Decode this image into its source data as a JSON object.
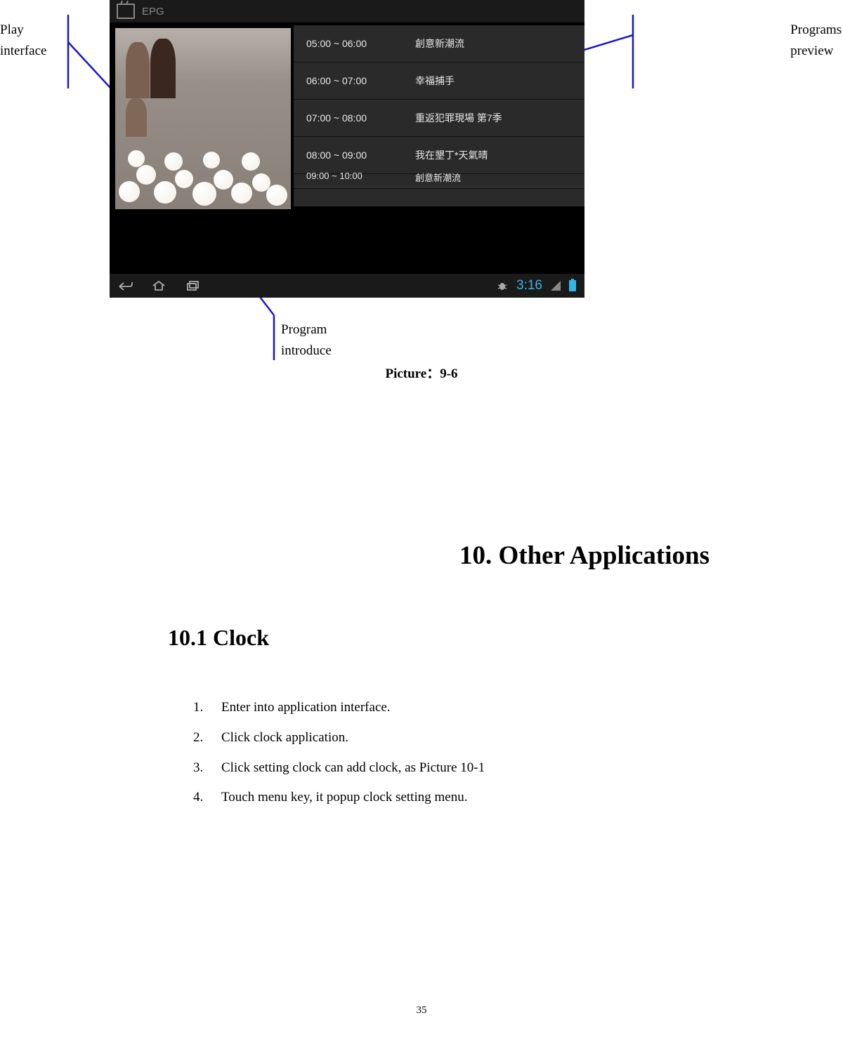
{
  "annotations": {
    "play_interface_l1": "Play",
    "play_interface_l2": "interface",
    "programs_preview_l1": "Programs",
    "programs_preview_l2": "preview",
    "program_introduce_l1": "Program",
    "program_introduce_l2": "introduce"
  },
  "screenshot": {
    "header_label": "EPG",
    "programs": [
      {
        "time": "05:00 ~ 06:00",
        "name": "創意新潮流"
      },
      {
        "time": "06:00 ~ 07:00",
        "name": "幸福捕手"
      },
      {
        "time": "07:00 ~ 08:00",
        "name": "重返犯罪現場 第7季"
      },
      {
        "time": "08:00 ~ 09:00",
        "name": "我在墾丁*天氣晴"
      },
      {
        "time": "09:00 ~ 10:00",
        "name": "創意新潮流"
      }
    ],
    "clock": "3:16"
  },
  "caption": "Picture：9-6",
  "chapter_title": "10. Other Applications",
  "section_title": "10.1 Clock",
  "steps": [
    {
      "num": "1.",
      "text": "Enter into application interface."
    },
    {
      "num": "2.",
      "text": "Click clock application."
    },
    {
      "num": "3.",
      "text": "Click setting clock can add clock, as Picture 10-1"
    },
    {
      "num": "4.",
      "text": "Touch menu key, it popup clock setting menu."
    }
  ],
  "page_number": "35"
}
